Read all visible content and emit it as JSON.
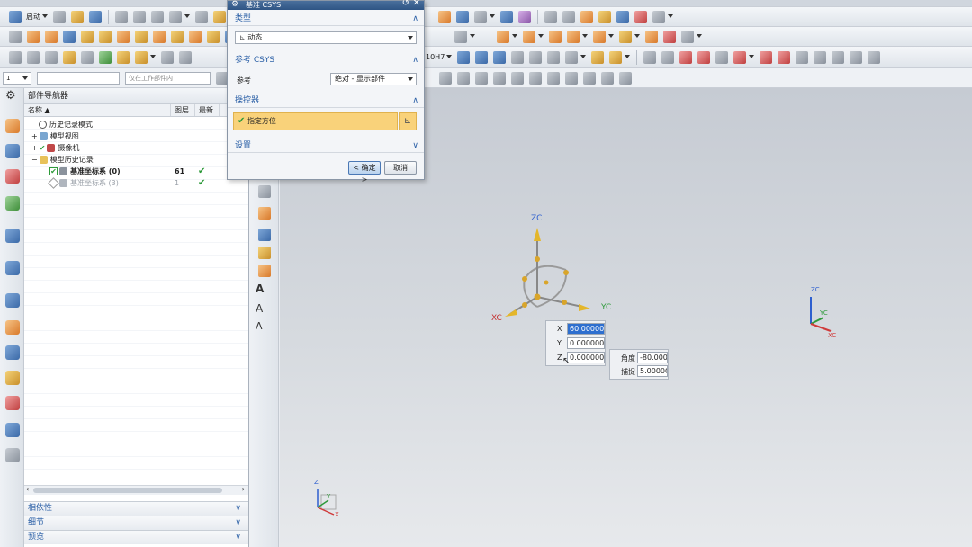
{
  "toolbar": {
    "start_label": "启动",
    "filter_value": "1",
    "scope_placeholder": "仅在工作部件内",
    "tolerance_label": "10H7"
  },
  "dialog": {
    "title": "基准 CSYS",
    "sections": {
      "type": "类型",
      "reference": "参考 CSYS",
      "manipulator": "操控器",
      "settings": "设置"
    },
    "type_value": "动态",
    "reference_label": "参考",
    "reference_value": "绝对 - 显示部件",
    "manipulator_item": "指定方位",
    "ok_label": "< 确定 >",
    "cancel_label": "取消"
  },
  "navigator": {
    "title": "部件导航器",
    "columns": {
      "name": "名称",
      "layer": "图层",
      "latest": "最新"
    },
    "items": [
      {
        "label": "历史记录模式"
      },
      {
        "label": "模型视图"
      },
      {
        "label": "摄像机"
      },
      {
        "label": "模型历史记录"
      },
      {
        "label": "基准坐标系 (0)",
        "layer": "61",
        "latest": "✔"
      },
      {
        "label": "基准坐标系 (3)",
        "layer": "1",
        "latest": "✔"
      }
    ],
    "panels": [
      "相依性",
      "细节",
      "预览"
    ]
  },
  "viewport": {
    "axes": {
      "zc": "ZC",
      "yc": "YC",
      "xc": "XC"
    },
    "coords": {
      "x_label": "X",
      "x_value": "60.00000",
      "y_label": "Y",
      "y_value": "0.000000C",
      "z_label": "Z",
      "z_value": "0.000000C"
    },
    "rotation": {
      "angle_label": "角度",
      "angle_value": "-80.000",
      "snap_label": "捕捉",
      "snap_value": "5.0000C"
    },
    "triad_labels": {
      "z": "ZC",
      "y": "YC",
      "x": "XC"
    },
    "corner_labels": {
      "z": "Z",
      "y": "Y",
      "x": "X"
    }
  }
}
